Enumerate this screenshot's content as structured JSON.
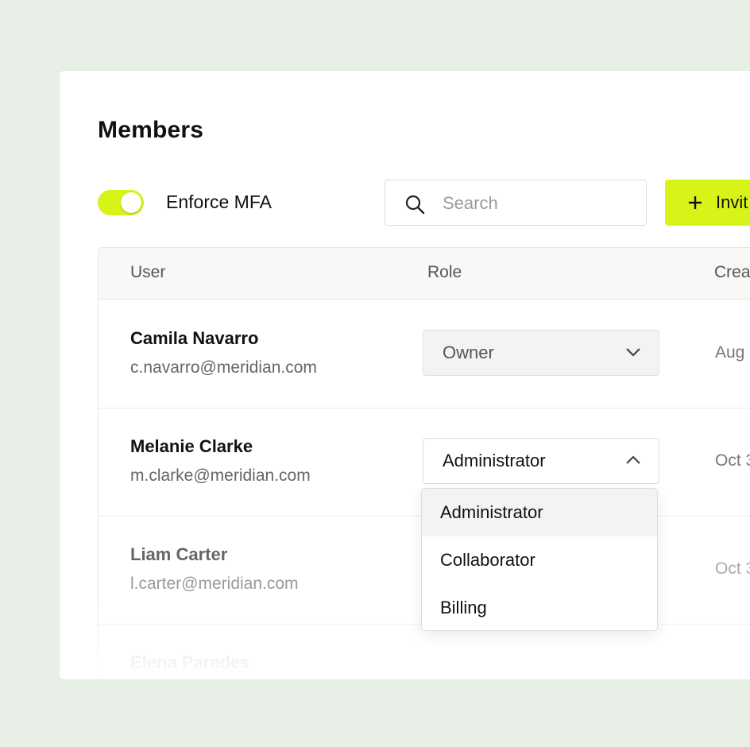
{
  "page": {
    "title": "Members"
  },
  "mfa": {
    "label": "Enforce MFA",
    "enabled": true
  },
  "search": {
    "placeholder": "Search"
  },
  "invite": {
    "label": "Invit"
  },
  "table": {
    "columns": [
      "User",
      "Role",
      "Crea"
    ],
    "rows": [
      {
        "name": "Camila Navarro",
        "email": "c.navarro@meridian.com",
        "role": "Owner",
        "date": "Aug"
      },
      {
        "name": "Melanie Clarke",
        "email": "m.clarke@meridian.com",
        "role": "Administrator",
        "date": "Oct 3"
      },
      {
        "name": "Liam Carter",
        "email": "l.carter@meridian.com",
        "role": "",
        "date": "Oct 3"
      },
      {
        "name": "Elena Paredes",
        "email": "",
        "role": "",
        "date": ""
      }
    ]
  },
  "role_dropdown": {
    "options": [
      "Administrator",
      "Collaborator",
      "Billing"
    ],
    "selected_index": 0
  },
  "colors": {
    "accent": "#d7f317",
    "background": "#e8efe6"
  }
}
